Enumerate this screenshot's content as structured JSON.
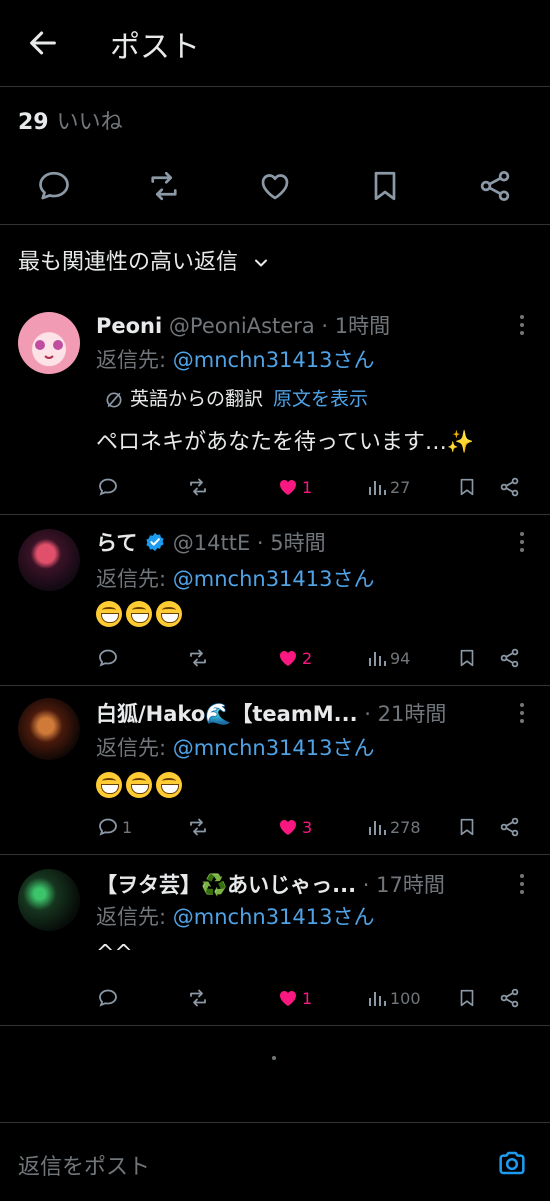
{
  "header": {
    "title": "ポスト"
  },
  "stats": {
    "like_count": "29",
    "like_label": "いいね"
  },
  "sort": {
    "label": "最も関連性の高い返信"
  },
  "compose": {
    "placeholder": "返信をポスト"
  },
  "colors": {
    "background": "#000000",
    "text": "#e7e9ea",
    "muted": "#71767b",
    "link": "#4fa3e6",
    "like": "#f91880",
    "border": "#2f3336"
  },
  "replies": [
    {
      "name": "Peoni",
      "handle": "@PeoniAstera",
      "time": "· 1時間",
      "reply_to_label": "返信先: ",
      "reply_to_mention": "@mnchn31413さん",
      "translation_label": "英語からの翻訳",
      "translation_link": "原文を表示",
      "text": "ペロネキがあなたを待っています…✨",
      "comments": "",
      "likes": "1",
      "views": "27",
      "liked": true
    },
    {
      "name": "らて",
      "handle": "@14ttE",
      "time": "· 5時間",
      "verified": true,
      "reply_to_label": "返信先: ",
      "reply_to_mention": "@mnchn31413さん",
      "comments": "",
      "likes": "2",
      "views": "94",
      "liked": true
    },
    {
      "name": "白狐/Hako🌊【teamM...",
      "handle": "",
      "time": "· 21時間",
      "reply_to_label": "返信先: ",
      "reply_to_mention": "@mnchn31413さん",
      "comments": "1",
      "likes": "3",
      "views": "278",
      "liked": true
    },
    {
      "name": "【ヲタ芸】♻️あいじゃっ...",
      "handle": "",
      "time": "· 17時間",
      "reply_to_label": "返信先: ",
      "reply_to_mention": "@mnchn31413さん",
      "text": "^^",
      "comments": "",
      "likes": "1",
      "views": "100",
      "liked": true
    }
  ]
}
